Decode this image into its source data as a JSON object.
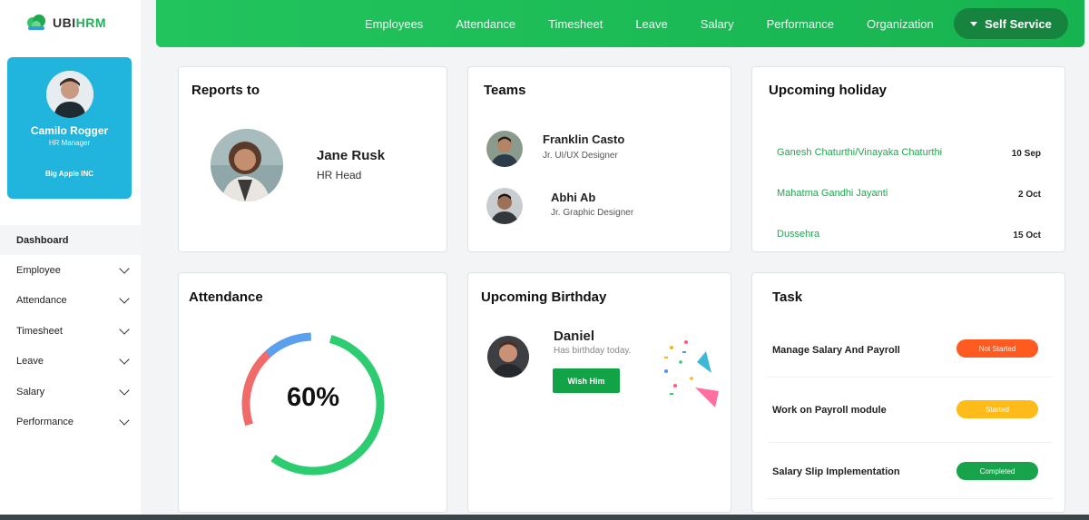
{
  "brand": {
    "prefix": "UBI",
    "suffix": "HRM",
    "accent": "#1fb25a"
  },
  "profile": {
    "name": "Camilo Rogger",
    "role": "HR Manager",
    "company": "Big Apple INC",
    "color": "#21b4dd"
  },
  "sidebar": {
    "items": [
      {
        "label": "Dashboard",
        "active": true
      },
      {
        "label": "Employee"
      },
      {
        "label": "Attendance"
      },
      {
        "label": "Timesheet"
      },
      {
        "label": "Leave"
      },
      {
        "label": "Salary"
      },
      {
        "label": "Performance"
      }
    ]
  },
  "topnav": {
    "items": [
      "Employees",
      "Attendance",
      "Timesheet",
      "Leave",
      "Salary",
      "Performance",
      "Organization"
    ],
    "self_service": "Self Service"
  },
  "reports_to": {
    "title": "Reports to",
    "name": "Jane Rusk",
    "role": "HR Head"
  },
  "teams": {
    "title": "Teams",
    "members": [
      {
        "name": "Franklin Casto",
        "role": "Jr. UI/UX Designer"
      },
      {
        "name": "Abhi Ab",
        "role": "Jr. Graphic Designer"
      }
    ]
  },
  "holidays": {
    "title": "Upcoming holiday",
    "items": [
      {
        "name": "Ganesh Chaturthi/Vinayaka Chaturthi",
        "date": "10 Sep"
      },
      {
        "name": "Mahatma Gandhi Jayanti",
        "date": "2 Oct"
      },
      {
        "name": "Dussehra",
        "date": "15 Oct"
      }
    ]
  },
  "attendance": {
    "title": "Attendance",
    "percent_label": "60%",
    "percent": 60,
    "colors": {
      "present": "#2ecc71",
      "absent": "#f06a6a",
      "leave": "#5aa0ee"
    }
  },
  "birthday": {
    "title": "Upcoming Birthday",
    "name": "Daniel",
    "note": "Has birthday today.",
    "button": "Wish Him"
  },
  "tasks": {
    "title": "Task",
    "items": [
      {
        "name": "Manage Salary And Payroll",
        "status": "Not Started",
        "color": "#ff5a1f"
      },
      {
        "name": "Work on Payroll module",
        "status": "Started",
        "color": "#ffbb1a"
      },
      {
        "name": "Salary Slip Implementation",
        "status": "Completed",
        "color": "#16a34a"
      }
    ]
  }
}
